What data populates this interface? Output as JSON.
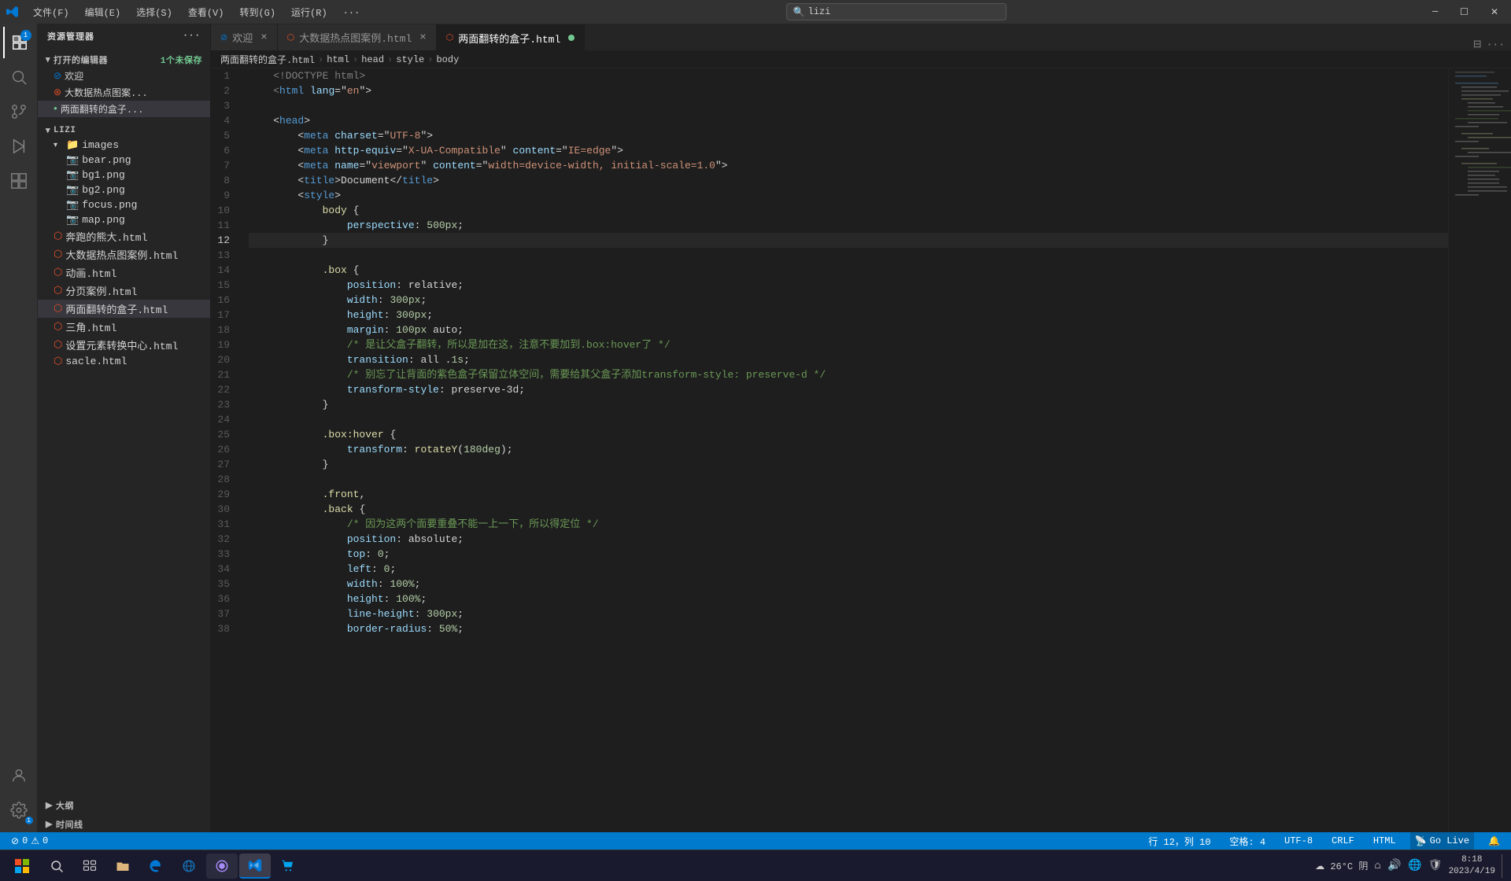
{
  "titleBar": {
    "menuItems": [
      "文件(F)",
      "编辑(E)",
      "选择(S)",
      "查看(V)",
      "转到(G)",
      "运行(R)",
      "..."
    ],
    "searchPlaceholder": "lizi",
    "windowControls": [
      "─",
      "☐",
      "✕"
    ]
  },
  "activityBar": {
    "icons": [
      {
        "name": "explorer-icon",
        "symbol": "⎘",
        "active": true,
        "badge": "1"
      },
      {
        "name": "search-icon",
        "symbol": "🔍",
        "active": false
      },
      {
        "name": "source-control-icon",
        "symbol": "⎇",
        "active": false
      },
      {
        "name": "run-icon",
        "symbol": "▷",
        "active": false
      },
      {
        "name": "extensions-icon",
        "symbol": "⊞",
        "active": false
      }
    ],
    "bottomIcons": [
      {
        "name": "account-icon",
        "symbol": "👤"
      },
      {
        "name": "settings-icon",
        "symbol": "⚙"
      }
    ]
  },
  "sidebar": {
    "title": "资源管理器",
    "moreIcon": "···",
    "sections": {
      "openEditors": {
        "label": "打开的编辑器",
        "badge": "1个未保存",
        "items": [
          {
            "name": "欢迎",
            "icon": "vscode",
            "active": false
          },
          {
            "name": "大数据热点图案...",
            "icon": "html",
            "modified": false
          },
          {
            "name": "两面翻转的盒子...",
            "icon": "html",
            "modified": true
          }
        ]
      },
      "explorer": {
        "label": "LIZI",
        "items": [
          {
            "label": "images",
            "type": "folder",
            "indent": 1,
            "expanded": true
          },
          {
            "label": "bear.png",
            "type": "png",
            "indent": 2
          },
          {
            "label": "bg1.png",
            "type": "png",
            "indent": 2
          },
          {
            "label": "bg2.png",
            "type": "png",
            "indent": 2
          },
          {
            "label": "focus.png",
            "type": "png",
            "indent": 2
          },
          {
            "label": "map.png",
            "type": "png",
            "indent": 2
          },
          {
            "label": "奔跑的熊大.html",
            "type": "html",
            "indent": 1
          },
          {
            "label": "大数据热点图案例.html",
            "type": "html",
            "indent": 1
          },
          {
            "label": "动画.html",
            "type": "html",
            "indent": 1
          },
          {
            "label": "分页案例.html",
            "type": "html",
            "indent": 1
          },
          {
            "label": "两面翻转的盒子.html",
            "type": "html",
            "indent": 1,
            "active": true
          },
          {
            "label": "三角.html",
            "type": "html",
            "indent": 1
          },
          {
            "label": "设置元素转换中心.html",
            "type": "html",
            "indent": 1
          },
          {
            "label": "sacle.html",
            "type": "html",
            "indent": 1
          }
        ]
      },
      "bottom": [
        {
          "label": "大纲",
          "collapsed": true
        },
        {
          "label": "时间线",
          "collapsed": true
        }
      ]
    }
  },
  "tabs": [
    {
      "label": "欢迎",
      "icon": "vscode",
      "active": false,
      "modified": false
    },
    {
      "label": "大数据热点图案例.html",
      "icon": "html",
      "active": false,
      "modified": false
    },
    {
      "label": "两面翻转的盒子.html",
      "icon": "html",
      "active": true,
      "modified": true
    }
  ],
  "breadcrumb": {
    "items": [
      "两面翻转的盒子.html",
      "html",
      "head",
      "style",
      "body"
    ]
  },
  "editor": {
    "lines": [
      {
        "num": 1,
        "tokens": [
          {
            "t": "    <!DOCTYPE html>",
            "c": "c-gray"
          }
        ]
      },
      {
        "num": 2,
        "tokens": [
          {
            "t": "    <html lang=\"en\">",
            "c": "c-white"
          }
        ]
      },
      {
        "num": 3,
        "tokens": []
      },
      {
        "num": 4,
        "tokens": [
          {
            "t": "    <head>",
            "c": "c-blue"
          }
        ]
      },
      {
        "num": 5,
        "tokens": [
          {
            "t": "        <meta charset=\"UTF-8\">",
            "c": "c-white"
          }
        ]
      },
      {
        "num": 6,
        "tokens": [
          {
            "t": "        <meta http-equiv=\"X-UA-Compatible\" content=\"IE=edge\">",
            "c": "c-white"
          }
        ]
      },
      {
        "num": 7,
        "tokens": [
          {
            "t": "        <meta name=\"viewport\" content=\"width=device-width, initial-scale=1.0\">",
            "c": "c-white"
          }
        ]
      },
      {
        "num": 8,
        "tokens": [
          {
            "t": "        <title>Document</title>",
            "c": "c-white"
          }
        ]
      },
      {
        "num": 9,
        "tokens": [
          {
            "t": "        <style>",
            "c": "c-blue"
          }
        ]
      },
      {
        "num": 10,
        "tokens": [
          {
            "t": "            body {",
            "c": "c-light-blue"
          }
        ]
      },
      {
        "num": 11,
        "tokens": [
          {
            "t": "                perspective: 500px;",
            "c": "c-white"
          }
        ]
      },
      {
        "num": 12,
        "tokens": [
          {
            "t": "            }",
            "c": "c-white"
          }
        ],
        "current": true
      },
      {
        "num": 13,
        "tokens": []
      },
      {
        "num": 14,
        "tokens": [
          {
            "t": "            .box {",
            "c": "c-yellow"
          }
        ]
      },
      {
        "num": 15,
        "tokens": [
          {
            "t": "                position: relative;",
            "c": "c-white"
          }
        ]
      },
      {
        "num": 16,
        "tokens": [
          {
            "t": "                width: 300px;",
            "c": "c-white"
          }
        ]
      },
      {
        "num": 17,
        "tokens": [
          {
            "t": "                height: 300px;",
            "c": "c-white"
          }
        ]
      },
      {
        "num": 18,
        "tokens": [
          {
            "t": "                margin: 100px auto;",
            "c": "c-white"
          }
        ]
      },
      {
        "num": 19,
        "tokens": [
          {
            "t": "                /* 是让父盒子翻转，所以是加在这，注意不要加到.box:hover了 */",
            "c": "c-green"
          }
        ]
      },
      {
        "num": 20,
        "tokens": [
          {
            "t": "                transition: all .1s;",
            "c": "c-white"
          }
        ]
      },
      {
        "num": 21,
        "tokens": [
          {
            "t": "                /* 别忘了让背面的紫色盒子保留立体空间，需要给其父盒子添加transform-style: preserve-d */",
            "c": "c-green"
          }
        ]
      },
      {
        "num": 22,
        "tokens": [
          {
            "t": "                transform-style: preserve-3d;",
            "c": "c-white"
          }
        ]
      },
      {
        "num": 23,
        "tokens": [
          {
            "t": "            }",
            "c": "c-white"
          }
        ]
      },
      {
        "num": 24,
        "tokens": []
      },
      {
        "num": 25,
        "tokens": [
          {
            "t": "            .box:hover {",
            "c": "c-yellow"
          }
        ]
      },
      {
        "num": 26,
        "tokens": [
          {
            "t": "                transform: rotateY(180deg);",
            "c": "c-white"
          }
        ]
      },
      {
        "num": 27,
        "tokens": [
          {
            "t": "            }",
            "c": "c-white"
          }
        ]
      },
      {
        "num": 28,
        "tokens": []
      },
      {
        "num": 29,
        "tokens": [
          {
            "t": "            .front,",
            "c": "c-yellow"
          }
        ]
      },
      {
        "num": 30,
        "tokens": [
          {
            "t": "            .back {",
            "c": "c-yellow"
          }
        ]
      },
      {
        "num": 31,
        "tokens": [
          {
            "t": "                /* 因为这两个面要重叠不能一上一下，所以得定位 */",
            "c": "c-green"
          }
        ]
      },
      {
        "num": 32,
        "tokens": [
          {
            "t": "                position: absolute;",
            "c": "c-white"
          }
        ]
      },
      {
        "num": 33,
        "tokens": [
          {
            "t": "                top: 0;",
            "c": "c-white"
          }
        ]
      },
      {
        "num": 34,
        "tokens": [
          {
            "t": "                left: 0;",
            "c": "c-white"
          }
        ]
      },
      {
        "num": 35,
        "tokens": [
          {
            "t": "                width: 100%;",
            "c": "c-white"
          }
        ]
      },
      {
        "num": 36,
        "tokens": [
          {
            "t": "                height: 100%;",
            "c": "c-white"
          }
        ]
      },
      {
        "num": 37,
        "tokens": [
          {
            "t": "                line-height: 300px;",
            "c": "c-white"
          }
        ]
      },
      {
        "num": 38,
        "tokens": [
          {
            "t": "                border-radius: 50%;",
            "c": "c-white"
          }
        ]
      }
    ]
  },
  "statusBar": {
    "left": [
      {
        "icon": "⚡",
        "text": "0"
      },
      {
        "icon": "🔔",
        "text": "0"
      }
    ],
    "right": [
      {
        "text": "行 12，列 10"
      },
      {
        "text": "空格: 4"
      },
      {
        "text": "UTF-8"
      },
      {
        "text": "CRLF"
      },
      {
        "text": "HTML"
      },
      {
        "text": "Go Live"
      },
      {
        "icon": "⬆"
      },
      {
        "text": "🔔"
      }
    ]
  },
  "taskbar": {
    "apps": [
      {
        "name": "windows-start",
        "label": "⊞"
      },
      {
        "name": "search-app",
        "label": "🔍"
      },
      {
        "name": "task-view",
        "label": "⧉"
      },
      {
        "name": "file-explorer-app",
        "label": "📁"
      },
      {
        "name": "edge-browser",
        "label": "🌐"
      },
      {
        "name": "ie-browser",
        "label": "🌍"
      },
      {
        "name": "vscode-app",
        "label": "VS",
        "active": true
      },
      {
        "name": "cortana",
        "label": "💠"
      },
      {
        "name": "store",
        "label": "🏪"
      }
    ],
    "systemTray": {
      "weather": "26°C 阴",
      "time": "8:18",
      "date": "2023/4/19"
    }
  }
}
